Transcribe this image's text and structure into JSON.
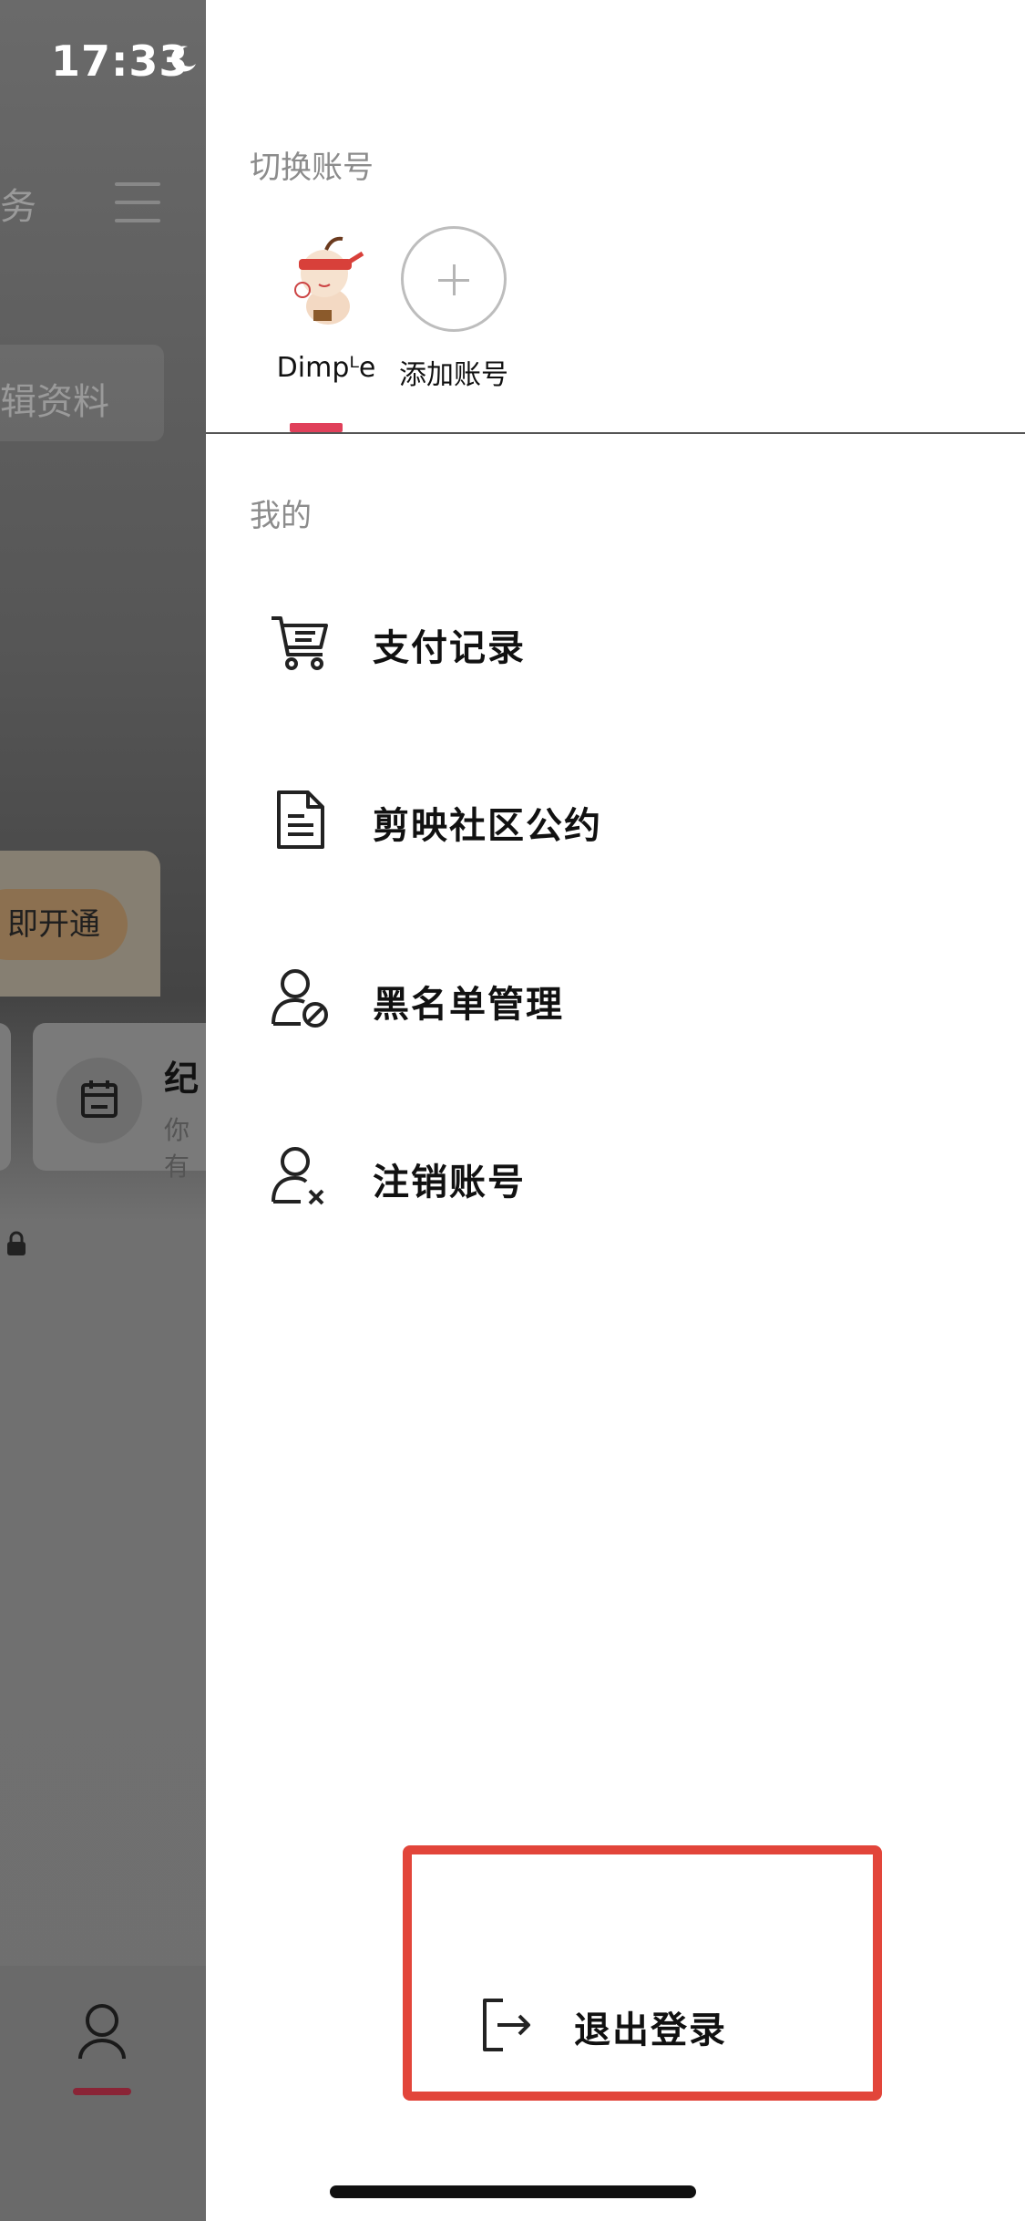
{
  "status_bar": {
    "time": "17:33",
    "moon_icon": "moon-icon"
  },
  "background": {
    "header_fragment": "务",
    "edit_profile_fragment": "辑资料",
    "vip_button_fragment": "即开通",
    "calendar_card": {
      "title_fragment": "纪",
      "subtitle_fragment": "你有"
    },
    "lock_icon": "lock-icon",
    "profile_tab_icon": "person-icon"
  },
  "drawer": {
    "switch_account_label": "切换账号",
    "accounts": [
      {
        "name": "Dimpᴸe",
        "avatar": "cartoon-avatar",
        "active": true
      }
    ],
    "add_account_label": "添加账号",
    "mine_label": "我的",
    "menu": [
      {
        "label": "支付记录",
        "icon": "cart-icon"
      },
      {
        "label": "剪映社区公约",
        "icon": "document-icon"
      },
      {
        "label": "黑名单管理",
        "icon": "user-block-icon"
      },
      {
        "label": "注销账号",
        "icon": "user-remove-icon"
      }
    ],
    "logout_label": "退出登录",
    "logout_icon": "logout-icon",
    "highlight_color": "#e2453a",
    "accent_color": "#e0405a"
  }
}
